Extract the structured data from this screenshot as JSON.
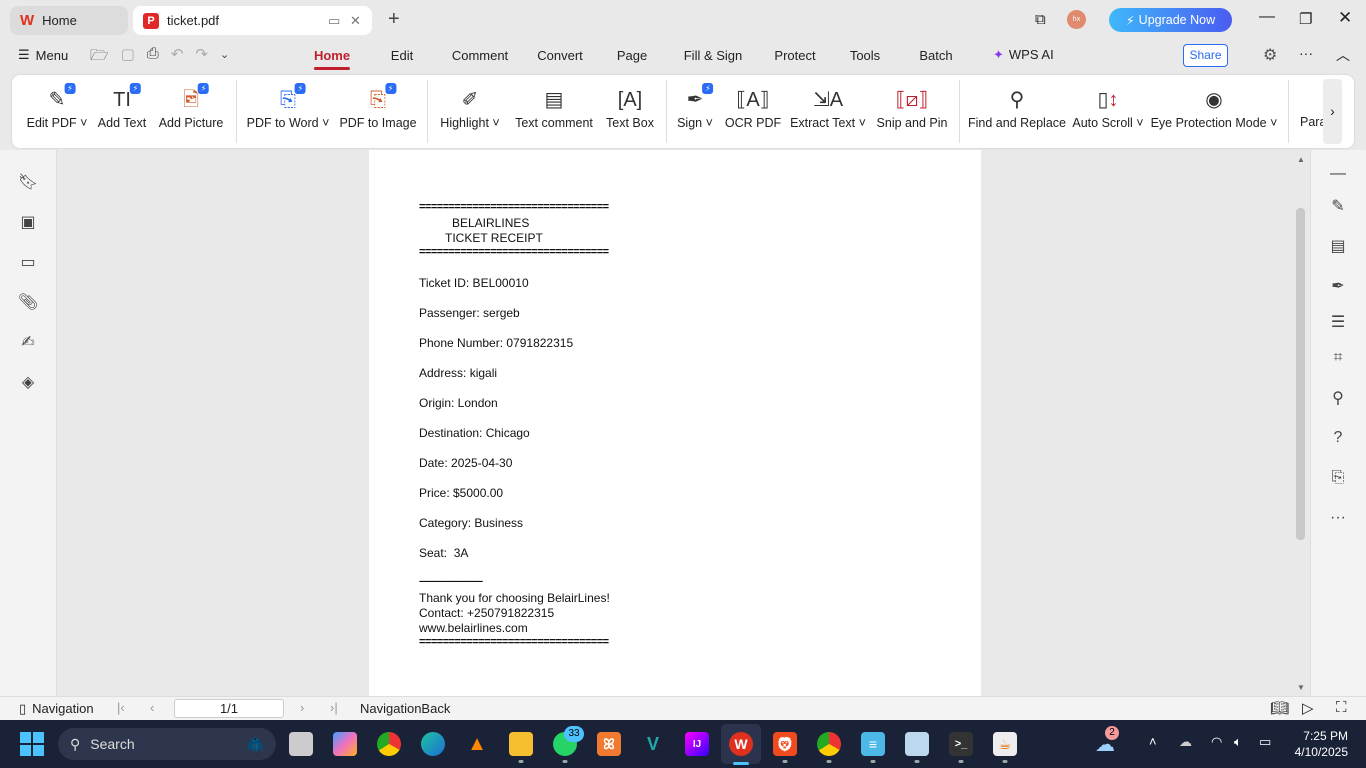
{
  "tabs": [
    {
      "label": "Home",
      "icon": "wps-logo-icon"
    },
    {
      "label": "ticket.pdf",
      "icon": "pdf-icon"
    }
  ],
  "titlebar": {
    "avatar": "hx",
    "upgrade": "Upgrade Now"
  },
  "menu": {
    "label": "Menu",
    "tabs": [
      "Home",
      "Edit",
      "Comment",
      "Convert",
      "Page",
      "Fill & Sign",
      "Protect",
      "Tools",
      "Batch"
    ],
    "active": "Home",
    "ai": "WPS AI",
    "share": "Share"
  },
  "ribbon": [
    {
      "label": "Edit PDF",
      "dropdown": true,
      "icon": "edit-pdf-icon"
    },
    {
      "label": "Add Text",
      "icon": "add-text-icon"
    },
    {
      "label": "Add Picture",
      "icon": "add-picture-icon"
    },
    {
      "label": "PDF to Word",
      "dropdown": true,
      "icon": "pdf-to-word-icon"
    },
    {
      "label": "PDF to Image",
      "icon": "pdf-to-image-icon"
    },
    {
      "label": "Highlight",
      "dropdown": true,
      "icon": "highlight-icon"
    },
    {
      "label": "Text comment",
      "icon": "text-comment-icon"
    },
    {
      "label": "Text Box",
      "icon": "text-box-icon"
    },
    {
      "label": "Sign",
      "dropdown": true,
      "icon": "sign-icon"
    },
    {
      "label": "OCR PDF",
      "icon": "ocr-icon"
    },
    {
      "label": "Extract Text",
      "dropdown": true,
      "icon": "extract-text-icon"
    },
    {
      "label": "Snip and Pin",
      "icon": "snip-icon"
    },
    {
      "label": "Find and Replace",
      "icon": "search-icon"
    },
    {
      "label": "Auto Scroll",
      "dropdown": true,
      "icon": "auto-scroll-icon"
    },
    {
      "label": "Eye Protection Mode",
      "dropdown": true,
      "icon": "eye-icon"
    },
    {
      "label": "Para",
      "icon": "paragraph-icon"
    }
  ],
  "document": {
    "rule": "================================",
    "title1": "BELAIRLINES",
    "title2": "TICKET RECEIPT",
    "fields": [
      "Ticket ID: BEL00010",
      "Passenger: sergeb",
      "Phone Number: 0791822315",
      "Address: kigali",
      "Origin: London",
      "Destination: Chicago",
      "Date: 2025-04-30",
      "Price: $5000.00",
      "Category: Business",
      "Seat:  3A"
    ],
    "dash": "-----------------------------------",
    "footer": [
      "Thank you for choosing BelairLines!",
      "Contact: +250791822315",
      "www.belairlines.com"
    ]
  },
  "status": {
    "navigation": "Navigation",
    "page": "1/1",
    "navback": "NavigationBack"
  },
  "taskbar": {
    "search": "Search",
    "whatsapp_badge": "33",
    "weather_badge": "2",
    "time": "7:25 PM",
    "date": "4/10/2025"
  },
  "colors": {
    "accent": "#c0202e",
    "share": "#2a6cf5",
    "taskbar": "#1a2238"
  }
}
